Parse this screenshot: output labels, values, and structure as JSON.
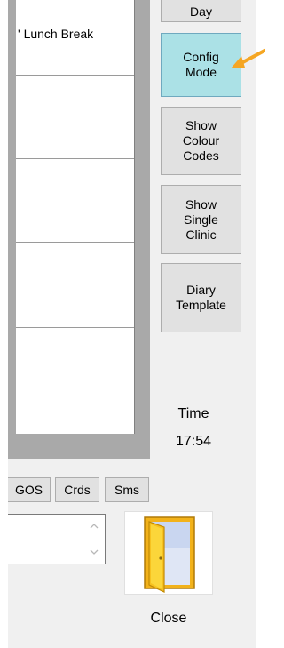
{
  "diary": {
    "entry_text": "' Lunch Break"
  },
  "side_buttons": {
    "top_partial": "Day",
    "config_mode": "Config\nMode",
    "show_colour_codes": "Show\nColour\nCodes",
    "show_single_clinic": "Show\nSingle\nClinic",
    "diary_template": "Diary\nTemplate"
  },
  "time": {
    "label": "Time",
    "value": "17:54"
  },
  "small_buttons": {
    "gos": "GOS",
    "crds": "Crds",
    "sms": "Sms"
  },
  "close": {
    "label": "Close"
  },
  "colors": {
    "active_button": "#abe1e6",
    "arrow": "#f5a623"
  },
  "icons": {
    "close": "open-door-icon",
    "scroll_up": "chevron-up-icon",
    "scroll_down": "chevron-down-icon"
  }
}
